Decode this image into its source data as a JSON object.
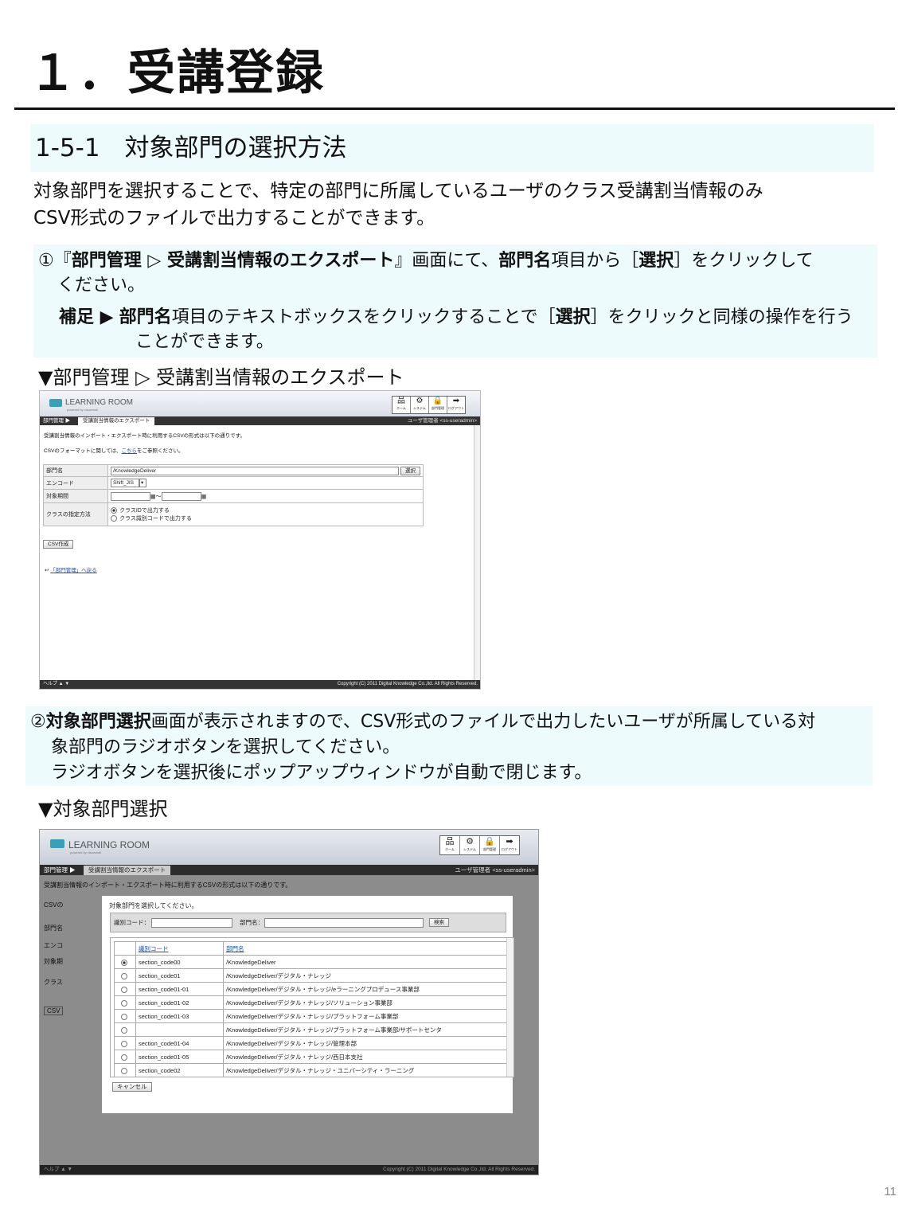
{
  "title": "１．受講登録",
  "section": "1-5-1　対象部門の選択方法",
  "intro": {
    "line1": "対象部門を選択することで、特定の部門に所属しているユーザのクラス受講割当情報のみ",
    "line2": "CSV形式のファイルで出力することができます。"
  },
  "step1": {
    "num": "①",
    "q_open": "『",
    "bold1": "部門管理 ▷ 受講割当情報のエクスポート",
    "q_close": "』",
    "t1": "画面にて、",
    "bold2": "部門名",
    "t2": "項目から［",
    "bold3": "選択",
    "t3": "］をクリックして",
    "line2": "ください。",
    "note_label": "補足 ▶",
    "note_bold": "部門名",
    "note_t1": "項目のテキストボックスをクリックすることで［",
    "note_bold2": "選択",
    "note_t2": "］をクリックと同様の操作を行う",
    "note_line2": "ことができます。"
  },
  "caption1": "▼部門管理 ▷ 受講割当情報のエクスポート",
  "step2": {
    "num": "②",
    "bold": "対象部門選択",
    "t1": "画面が表示されますので、CSV形式のファイルで出力したいユーザが所属している対",
    "line2": "象部門のラジオボタンを選択してください。",
    "line3": "ラジオボタンを選択後にポップアップウィンドウが自動で閉じます。"
  },
  "caption2": "▼対象部門選択",
  "app": {
    "logo": "LEARNING ROOM",
    "logo_sub": "powered by visuwmall",
    "icons": [
      {
        "label": "ホーム",
        "glyph": "品",
        "icon": "home-icon"
      },
      {
        "label": "システム",
        "glyph": "⚙",
        "icon": "system-icon"
      },
      {
        "label": "部門管理",
        "glyph": "🔒",
        "icon": "department-icon"
      },
      {
        "label": "ログアウト",
        "glyph": "➡",
        "icon": "logout-icon"
      }
    ],
    "crumb_parent": "部門管理 ▶",
    "crumb_current": "受講割当情報のエクスポート",
    "user": "ユーザ管理者 <ss-useradmin>",
    "desc": "受講割当情報のインポート・エクスポート時に利用するCSVの形式は以下の通りです。",
    "csv_note_pre": "CSVのフォーマットに関しては、",
    "csv_note_link": "こちら",
    "csv_note_post": "をご参照ください。",
    "form": {
      "dept_label": "部門名",
      "dept_value": "/KnowledgeDeliver",
      "select_btn": "選択",
      "encode_label": "エンコード",
      "encode_value": "Shift_JIS",
      "period_label": "対象期間",
      "period_sep": "〜",
      "method_label": "クラスの指定方法",
      "method_opt1": "クラスIDで出力する",
      "method_opt2": "クラス識別コードで出力する"
    },
    "csv_btn": "CSV作成",
    "back_link": "「部門管理」へ戻る",
    "footer_left": "ヘルプ ▲ ▼",
    "footer_right": "Copyright (C) 2011 Digital Knowledge Co.,ltd. All Rights Reserved."
  },
  "popup": {
    "instruction": "対象部門を選択してください。",
    "code_label": "識別コード：",
    "name_label": "部門名：",
    "search_btn": "検索",
    "col_code": "識別コード",
    "col_name": "部門名",
    "rows": [
      {
        "code": "section_code00",
        "name": "/KnowledgeDeliver"
      },
      {
        "code": "section_code01",
        "name": "/KnowledgeDeliver/デジタル・ナレッジ"
      },
      {
        "code": "section_code01-01",
        "name": "/KnowledgeDeliver/デジタル・ナレッジ/eラーニングプロデュース事業部"
      },
      {
        "code": "section_code01-02",
        "name": "/KnowledgeDeliver/デジタル・ナレッジ/ソリューション事業部"
      },
      {
        "code": "section_code01-03",
        "name": "/KnowledgeDeliver/デジタル・ナレッジ/プラットフォーム事業部"
      },
      {
        "code": "",
        "name": "/KnowledgeDeliver/デジタル・ナレッジ/プラットフォーム事業部/サポートセンタ"
      },
      {
        "code": "section_code01-04",
        "name": "/KnowledgeDeliver/デジタル・ナレッジ/管理本部"
      },
      {
        "code": "section_code01-05",
        "name": "/KnowledgeDeliver/デジタル・ナレッジ/西日本支社"
      },
      {
        "code": "section_code02",
        "name": "/KnowledgeDeliver/デジタル・ナレッジ・ユニバーシティ・ラーニング"
      }
    ],
    "cancel_btn": "キャンセル",
    "bg_labels": [
      "CSVの",
      "部門名",
      "エンコ",
      "対象期",
      "クラス",
      "CSV"
    ]
  },
  "page_number": "11"
}
